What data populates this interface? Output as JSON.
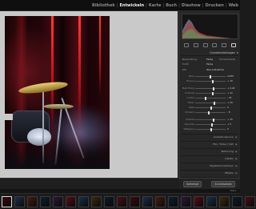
{
  "modules": {
    "items": [
      {
        "label": "Bibliothek",
        "active": false
      },
      {
        "label": "Entwickeln",
        "active": true
      },
      {
        "label": "Karte",
        "active": false
      },
      {
        "label": "Buch",
        "active": false
      },
      {
        "label": "Diashow",
        "active": false
      },
      {
        "label": "Drucken",
        "active": false
      },
      {
        "label": "Web",
        "active": false
      }
    ],
    "separator": "|"
  },
  "panel": {
    "basic_header": "Grundeinstellungen",
    "treatment_label": "Behandlung",
    "treatment_options": [
      "Farbe",
      "Schwarzweiß"
    ],
    "profile_label": "Profil",
    "profile_value": "Farbe",
    "wb_label": "WA",
    "wb_value": "Wie Aufnahme",
    "sliders": [
      {
        "label": "Temp",
        "value": "4.950"
      },
      {
        "label": "Tönung",
        "value": "+ 10"
      },
      {
        "label": "Belichtung",
        "value": "+ 0,40"
      },
      {
        "label": "Kontrast",
        "value": "+ 12"
      },
      {
        "label": "Lichter",
        "value": "- 35"
      },
      {
        "label": "Tiefen",
        "value": "+ 20"
      },
      {
        "label": "Weiß",
        "value": "0"
      },
      {
        "label": "Schwarz",
        "value": "- 8"
      },
      {
        "label": "Klarheit",
        "value": "+ 15"
      },
      {
        "label": "Dynamik",
        "value": "+ 5"
      },
      {
        "label": "Sättigung",
        "value": "0"
      }
    ],
    "collapsed_sections": [
      "Gradationskurve",
      "HSL / Farbe / S/W",
      "Teiltonung",
      "Details",
      "Objektivkorrekturen",
      "Effekte",
      "Kamerakalibrierung"
    ],
    "buttons": {
      "previous": "Vorherige",
      "reset": "Zurücksetzen"
    }
  },
  "filmstrip": {
    "info": "Filter:",
    "thumbnail_count": 20,
    "selected_index": 0
  },
  "colors": {
    "accent_text": "#f2f2f2",
    "panel_bg": "#272727",
    "canvas_bg": "#c9c9c9"
  },
  "icons": [
    "crop-icon",
    "spot-removal-icon",
    "red-eye-icon",
    "graduated-filter-icon",
    "radial-filter-icon",
    "brush-icon"
  ]
}
